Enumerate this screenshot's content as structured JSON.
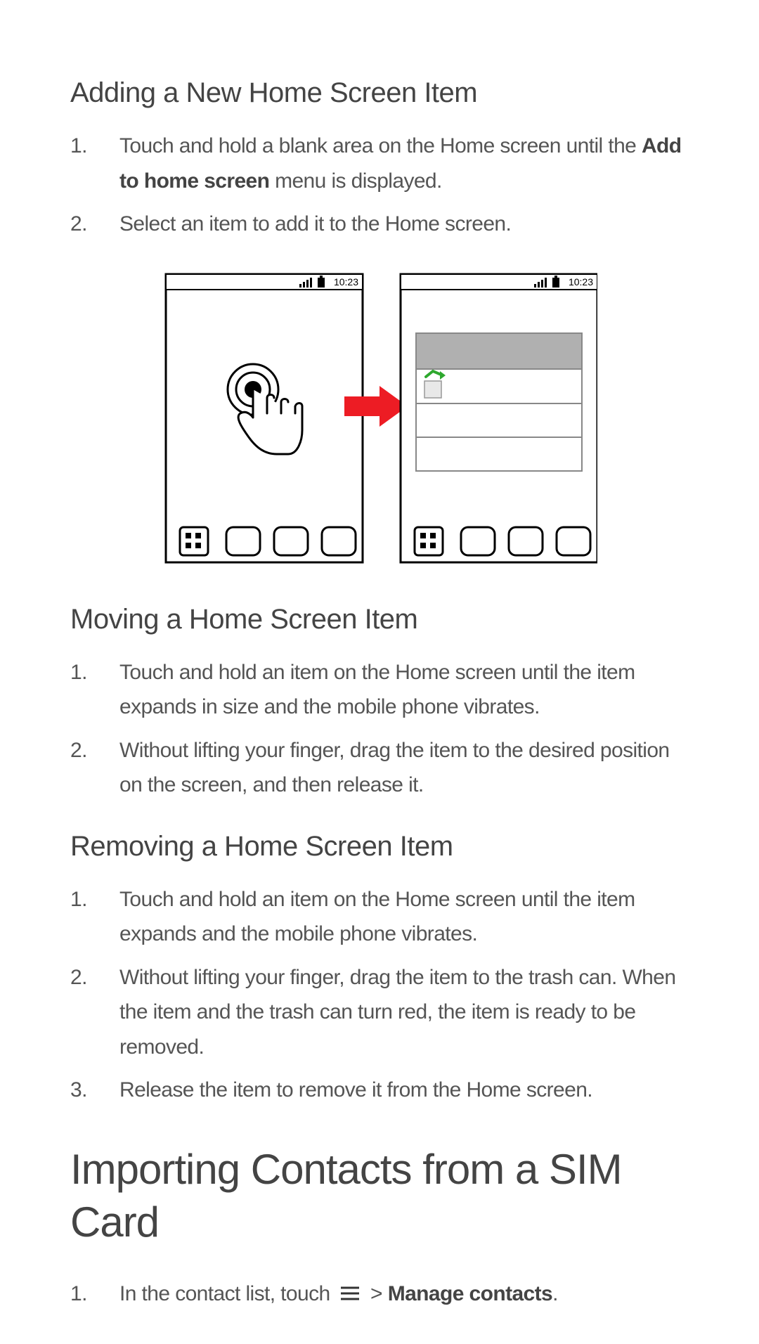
{
  "sections": {
    "adding": {
      "title": "Adding a New Home Screen Item",
      "steps": {
        "s1a": "Touch and hold a blank area on the Home screen until the ",
        "s1b": "Add to home screen",
        "s1c": " menu is displayed.",
        "s2": "Select an item to add it to the Home screen."
      }
    },
    "moving": {
      "title": "Moving a Home Screen Item",
      "steps": {
        "s1": "Touch and hold an item on the Home screen until the item expands in size and the mobile phone vibrates.",
        "s2": "Without lifting your finger, drag the item to the desired position on the screen, and then release it."
      }
    },
    "removing": {
      "title": "Removing a Home Screen Item",
      "steps": {
        "s1": "Touch and hold an item on the Home screen until the item expands and the mobile phone vibrates.",
        "s2": "Without lifting your finger, drag the item to the trash can. When the item and the trash can turn red, the item is ready to be removed.",
        "s3": "Release the item to remove it from the Home screen."
      }
    },
    "importing": {
      "title": "Importing Contacts from a SIM Card",
      "steps": {
        "s1a": "In the contact list, touch ",
        "s1b": " > ",
        "s1c": "Manage contacts",
        "s1d": "."
      }
    }
  },
  "figure": {
    "time_left": "10:23",
    "time_right": "10:23"
  }
}
